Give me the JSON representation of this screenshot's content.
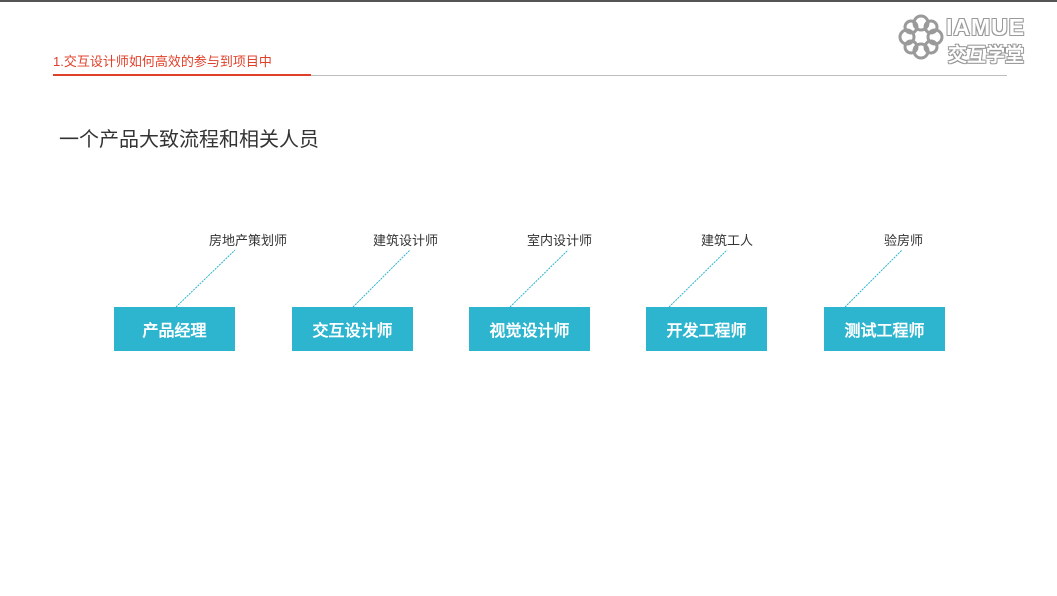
{
  "header": {
    "section_title": "1.交互设计师如何高效的参与到项目中",
    "accent_color": "#e0402a"
  },
  "logo": {
    "text_en": "IAMUE",
    "text_cn": "交互学堂",
    "icon": "flower-knot-icon"
  },
  "main": {
    "heading": "一个产品大致流程和相关人员"
  },
  "flow": {
    "box_color": "#2db5cf",
    "connector_color": "#2db5cf",
    "roles": [
      {
        "label": "产品经理",
        "related": "房地产策划师"
      },
      {
        "label": "交互设计师",
        "related": "建筑设计师"
      },
      {
        "label": "视觉设计师",
        "related": "室内设计师"
      },
      {
        "label": "开发工程师",
        "related": "建筑工人"
      },
      {
        "label": "测试工程师",
        "related": "验房师"
      }
    ]
  }
}
